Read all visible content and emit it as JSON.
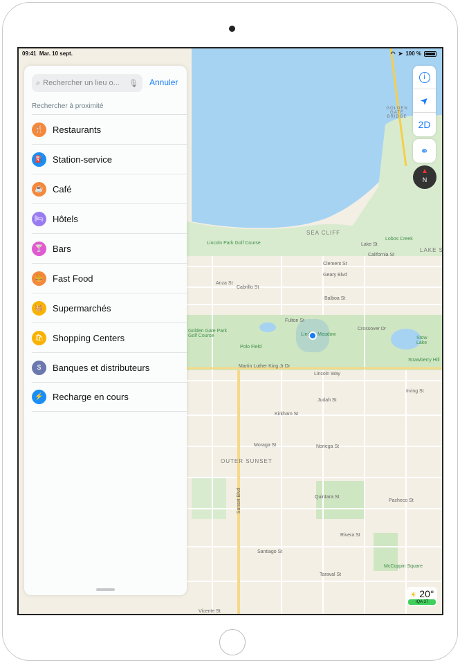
{
  "status_bar": {
    "time": "09:41",
    "date": "Mar. 10 sept.",
    "battery": "100 %",
    "battery_level": 1.0
  },
  "search": {
    "placeholder": "Rechercher un lieu o...",
    "cancel": "Annuler",
    "nearby_title": "Rechercher à proximité"
  },
  "categories": [
    {
      "label": "Restaurants",
      "icon": "fork-knife-icon",
      "color": "#f5883a",
      "glyph": "🍴"
    },
    {
      "label": "Station-service",
      "icon": "fuel-pump-icon",
      "color": "#1b8ef5",
      "glyph": "⛽"
    },
    {
      "label": "Café",
      "icon": "coffee-cup-icon",
      "color": "#f5883a",
      "glyph": "☕"
    },
    {
      "label": "Hôtels",
      "icon": "bed-icon",
      "color": "#9a7cf2",
      "glyph": "🛏"
    },
    {
      "label": "Bars",
      "icon": "cocktail-icon",
      "color": "#e05ad2",
      "glyph": "🍸"
    },
    {
      "label": "Fast Food",
      "icon": "fast-food-icon",
      "color": "#f5883a",
      "glyph": "🍔"
    },
    {
      "label": "Supermarchés",
      "icon": "basket-icon",
      "color": "#f9b200",
      "glyph": "🧺"
    },
    {
      "label": "Shopping Centers",
      "icon": "shopping-bag-icon",
      "color": "#f9b200",
      "glyph": "🛍"
    },
    {
      "label": "Banques et distributeurs",
      "icon": "bank-icon",
      "color": "#6a78ad",
      "glyph": "$"
    },
    {
      "label": "Recharge en cours",
      "icon": "ev-charger-icon",
      "color": "#1b8ef5",
      "glyph": "⚡"
    }
  ],
  "controls": {
    "info": "i",
    "view_mode": "2D",
    "compass": "N"
  },
  "weather": {
    "temp": "20°",
    "aqi": "IQA 37"
  },
  "map_labels": {
    "bridge": "GOLDEN GATE BRIDGE",
    "sea_cliff": "SEA CLIFF",
    "lincoln_park": "Lincoln Park Golf Course",
    "lobos": "Lobos Creek",
    "lake": "LAKE S",
    "clement": "Clement St",
    "geary": "Geary Blvd",
    "balboa": "Balboa St",
    "cabrillo": "Cabrillo St",
    "anza": "Anza St",
    "lake_st": "Lake St",
    "california": "California St",
    "fulton": "Fulton St",
    "crossover": "Crossover Dr",
    "gg_park": "Golden Gate Park Golf Course",
    "polo": "Polo Field",
    "meadow": "Lindley Meadow",
    "stow": "Stow Lake",
    "strawberry": "Strawberry Hill",
    "mlk": "Martin Luther King Jr Dr",
    "lincoln_way": "Lincoln Way",
    "judah": "Judah St",
    "irving": "Irving St",
    "kirkham": "Kirkham St",
    "moraga": "Moraga St",
    "noriega": "Noriega St",
    "outer_sunset": "OUTER SUNSET",
    "quintara": "Quintara St",
    "pacheco": "Pacheco St",
    "rivera": "Rivera St",
    "santiago": "Santiago St",
    "taraval": "Taraval St",
    "vicente": "Vicente St",
    "sunset_blvd": "Sunset Blvd",
    "mccoppin": "McCoppin Square"
  }
}
